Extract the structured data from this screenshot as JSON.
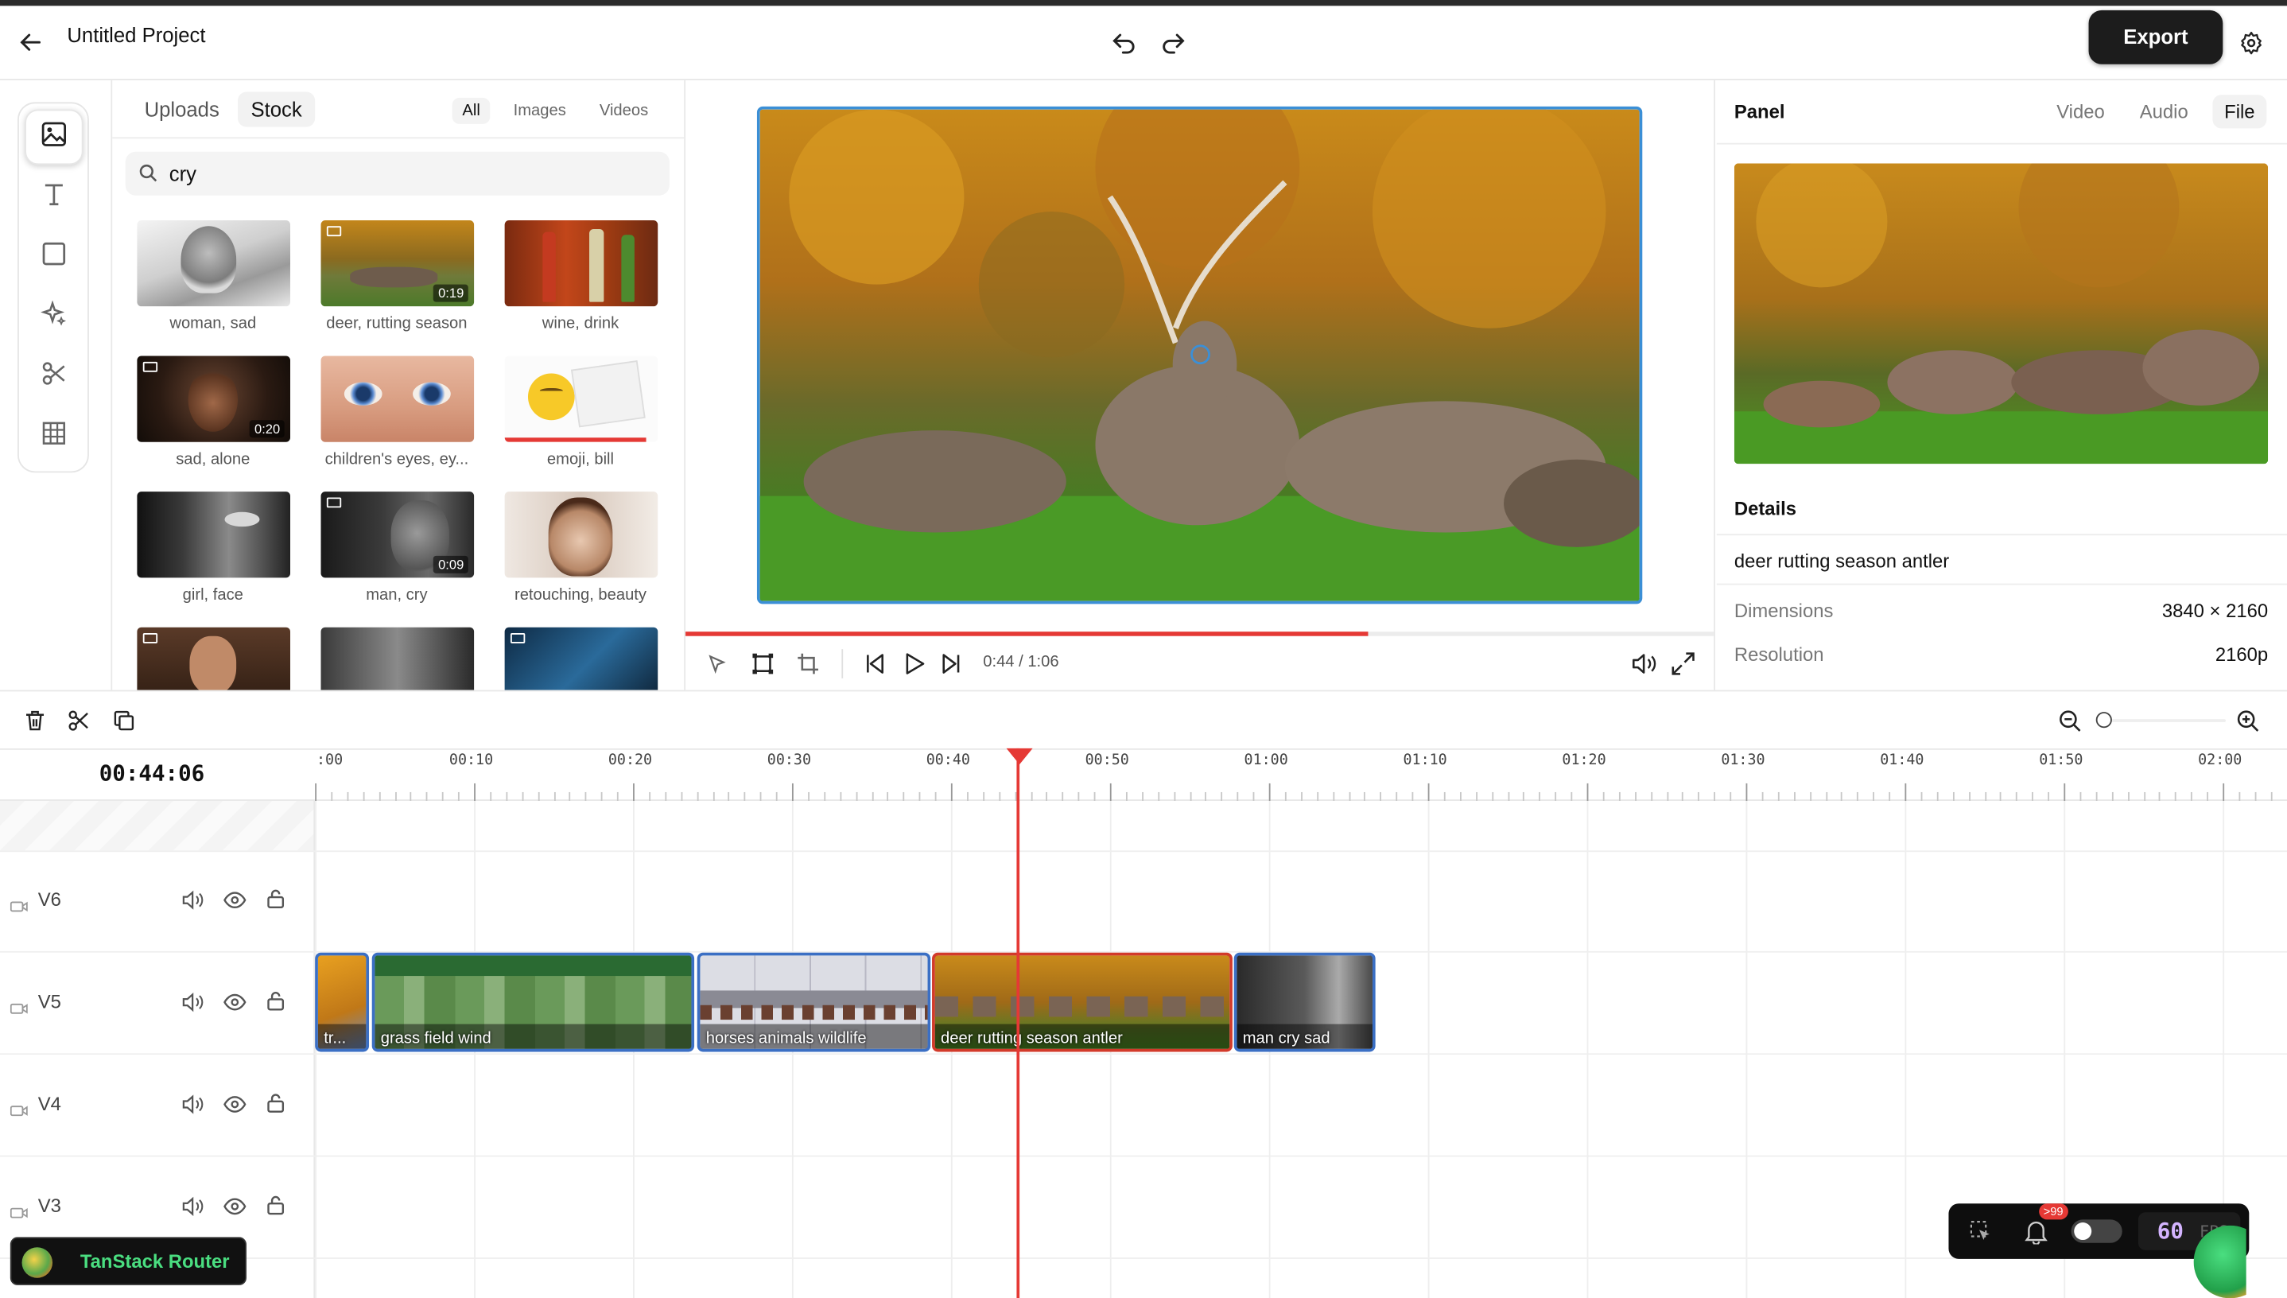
{
  "header": {
    "project_title": "Untitled Project",
    "export_label": "Export"
  },
  "sidebar": {
    "tools": [
      "image-icon",
      "text-icon",
      "shape-icon",
      "sparkle-icon",
      "scissors-icon",
      "grid-icon"
    ]
  },
  "media": {
    "tabs": [
      "Uploads",
      "Stock"
    ],
    "active_tab": "Stock",
    "filters": [
      "All",
      "Images",
      "Videos"
    ],
    "active_filter": "All",
    "search_value": "cry",
    "items": [
      {
        "label": "woman, sad",
        "duration": ""
      },
      {
        "label": "deer, rutting season",
        "duration": "0:19"
      },
      {
        "label": "wine, drink",
        "duration": ""
      },
      {
        "label": "sad, alone",
        "duration": "0:20"
      },
      {
        "label": "children's eyes, ey...",
        "duration": ""
      },
      {
        "label": "emoji, bill",
        "duration": ""
      },
      {
        "label": "girl, face",
        "duration": ""
      },
      {
        "label": "man, cry",
        "duration": "0:09"
      },
      {
        "label": "retouching, beauty",
        "duration": ""
      }
    ]
  },
  "player": {
    "time": "0:44 / 1:06",
    "progress_fraction": 0.664
  },
  "panel": {
    "title": "Panel",
    "tabs": [
      "Video",
      "Audio",
      "File"
    ],
    "active_tab": "File",
    "details_heading": "Details",
    "file_name": "deer rutting season antler",
    "rows": [
      {
        "label": "Dimensions",
        "value": "3840 × 2160"
      },
      {
        "label": "Resolution",
        "value": "2160p"
      }
    ]
  },
  "timeline": {
    "timecode": "00:44:06",
    "ruler_labels": [
      ":00",
      "00:10",
      "00:20",
      "00:30",
      "00:40",
      "00:50",
      "01:00",
      "01:10",
      "01:20",
      "01:30",
      "01:40",
      "01:50",
      "02:00"
    ],
    "tracks": [
      "V6",
      "V5",
      "V4",
      "V3"
    ],
    "clips": [
      {
        "label": "tr...",
        "track": "V5"
      },
      {
        "label": "grass field wind",
        "track": "V5"
      },
      {
        "label": "horses animals wildlife",
        "track": "V5"
      },
      {
        "label": "deer rutting season antler",
        "track": "V5"
      },
      {
        "label": "man cry sad",
        "track": "V5"
      }
    ]
  },
  "devtools": {
    "router_label": "TanStack Router",
    "notif_badge": ">99",
    "fps_value": "60",
    "fps_unit": "FPS"
  },
  "colors": {
    "accent": "#3b8fd6",
    "playhead": "#e53935",
    "export_bg": "#1c1c1c"
  }
}
